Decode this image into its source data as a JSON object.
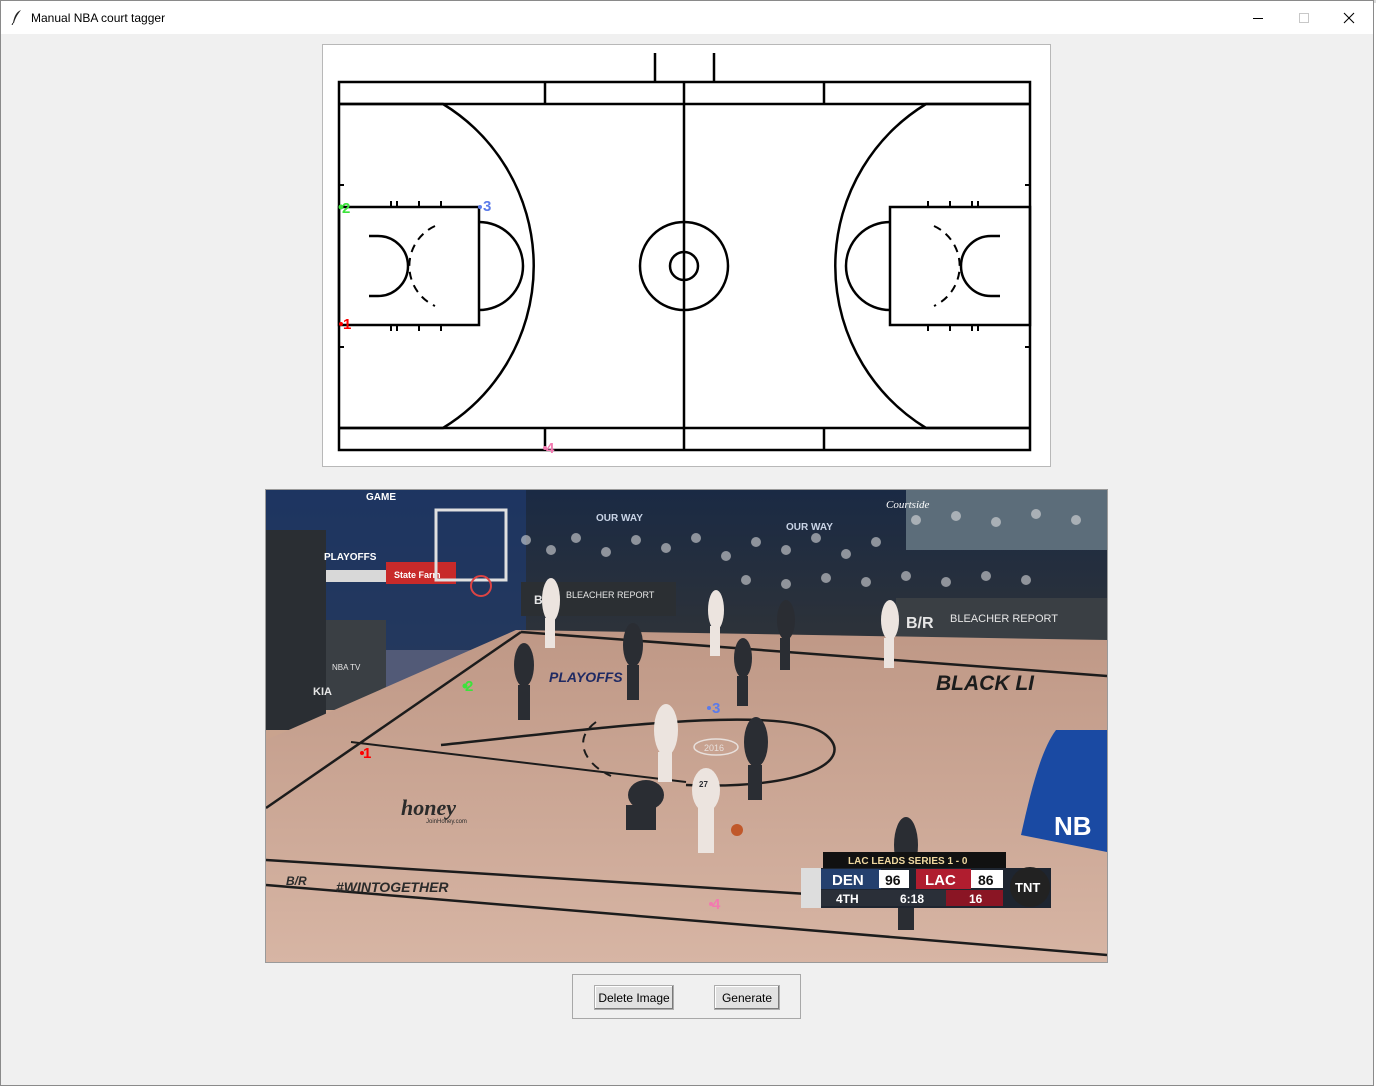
{
  "window": {
    "title": "Manual NBA court tagger",
    "icon": "feather-icon",
    "controls": [
      "minimize-icon",
      "maximize-icon",
      "close-icon"
    ]
  },
  "court_diagram": {
    "markers": [
      {
        "label": "1",
        "color": "#ff0000"
      },
      {
        "label": "2",
        "color": "#3be33b"
      },
      {
        "label": "3",
        "color": "#5b7bea"
      },
      {
        "label": "4",
        "color": "#f27ab0"
      }
    ]
  },
  "video_frame": {
    "markers": [
      {
        "label": "1",
        "color": "#ff0000"
      },
      {
        "label": "2",
        "color": "#3be33b"
      },
      {
        "label": "3",
        "color": "#5b7bea"
      },
      {
        "label": "4",
        "color": "#f27ab0"
      }
    ],
    "floor_texts": {
      "playoffs": "PLAYOFFS",
      "honey": "honey",
      "honey_url": "JoinHoney.com",
      "wintogether": "#WINTOGETHER",
      "black_lives": "BLACK LI",
      "bleacher_report": "BLEACHER REPORT",
      "br_logo": "B/R",
      "nba": "NB",
      "state_farm": "State Farm",
      "kia": "KIA",
      "nba_tv": "NBA TV",
      "courtside": "Courtside",
      "our_way": "OUR WAY",
      "game": "GAME",
      "jersey_27": "27",
      "court_plate": "2016"
    },
    "scoreboard": {
      "banner": "LAC LEADS SERIES 1 - 0",
      "team1": "DEN",
      "score1": "96",
      "team2": "LAC",
      "score2": "86",
      "period": "4TH",
      "clock": "6:18",
      "shot_clock": "16",
      "network": "TNT"
    }
  },
  "buttons": {
    "delete_label": "Delete Image",
    "generate_label": "Generate"
  }
}
